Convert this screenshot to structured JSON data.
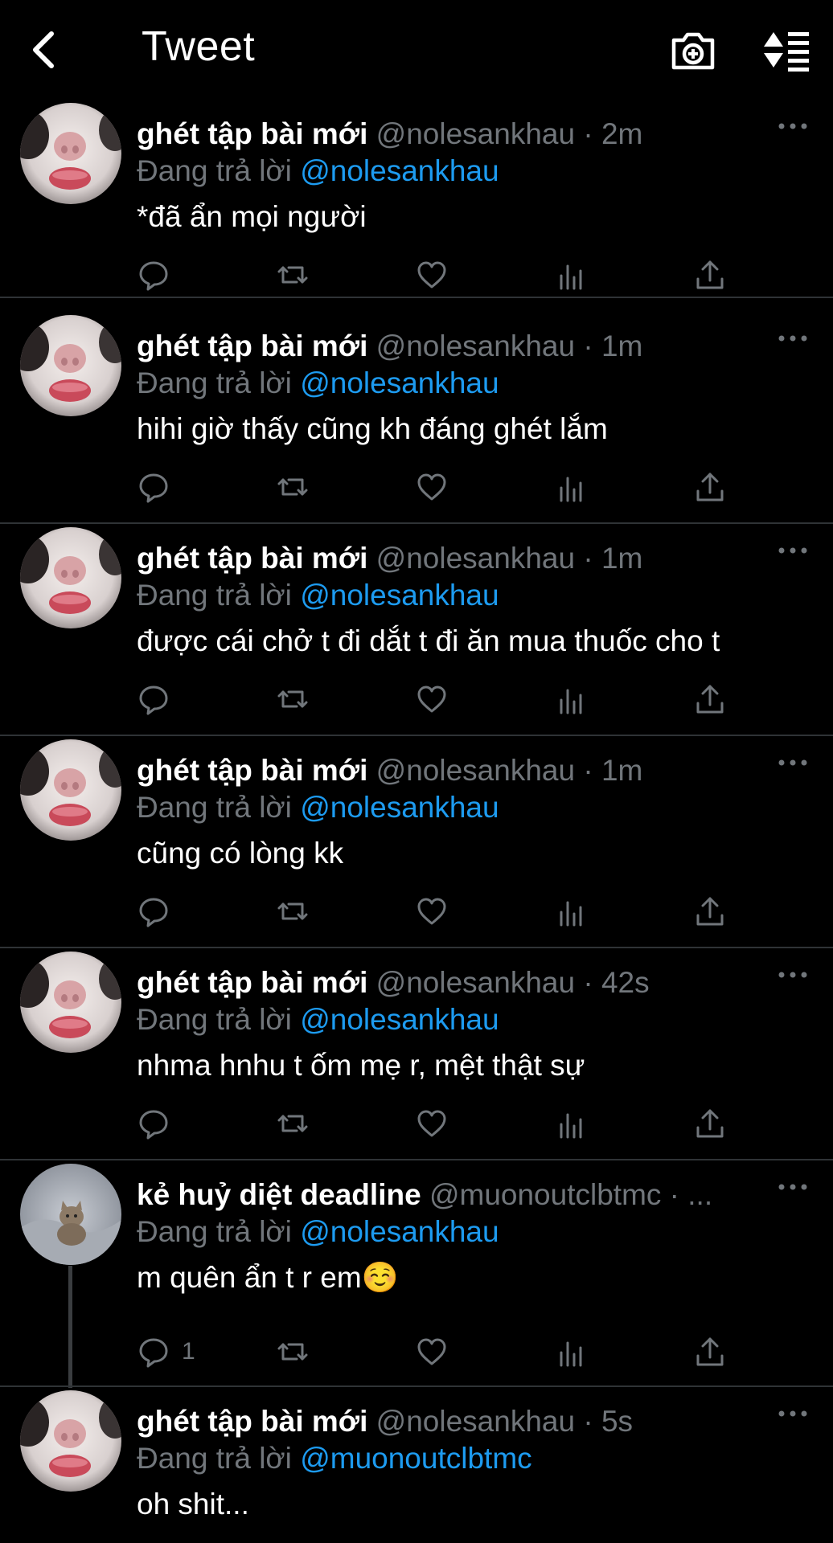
{
  "header": {
    "title": "Tweet",
    "back_icon": "chevron-left-icon",
    "camera_icon": "camera-icon",
    "sort_icon": "sort-icon"
  },
  "colors": {
    "background": "#000000",
    "link": "#1d9bf0",
    "muted": "#71767b"
  },
  "tweets": [
    {
      "name": "ghét tập bài mới",
      "handle": "@nolesankhau",
      "time": "· 2m",
      "reply_prefix": "Đang trả lời",
      "reply_to": "@nolesankhau",
      "text": "*đã ẩn mọi người",
      "reply_count": ""
    },
    {
      "name": "ghét tập bài mới",
      "handle": "@nolesankhau",
      "time": "· 1m",
      "reply_prefix": "Đang trả lời",
      "reply_to": "@nolesankhau",
      "text": "hihi giờ thấy cũng kh đáng ghét lắm",
      "reply_count": ""
    },
    {
      "name": "ghét tập bài mới",
      "handle": "@nolesankhau",
      "time": "· 1m",
      "reply_prefix": "Đang trả lời",
      "reply_to": "@nolesankhau",
      "text": "được cái chở t đi dắt t đi ăn mua thuốc cho t",
      "reply_count": ""
    },
    {
      "name": "ghét tập bài mới",
      "handle": "@nolesankhau",
      "time": "· 1m",
      "reply_prefix": "Đang trả lời",
      "reply_to": "@nolesankhau",
      "text": "cũng có lòng kk",
      "reply_count": ""
    },
    {
      "name": "ghét tập bài mới",
      "handle": "@nolesankhau",
      "time": "· 42s",
      "reply_prefix": "Đang trả lời",
      "reply_to": "@nolesankhau",
      "text": "nhma hnhu t ốm mẹ r, mệt thật sự",
      "reply_count": ""
    },
    {
      "name": "kẻ huỷ diệt deadline",
      "handle": "@muonoutclbtmc",
      "time": "· ...",
      "reply_prefix": "Đang trả lời",
      "reply_to": "@nolesankhau",
      "text": "m quên ẩn t r em☺️",
      "reply_count": "1"
    },
    {
      "name": "ghét tập bài mới",
      "handle": "@nolesankhau",
      "time": "· 5s",
      "reply_prefix": "Đang trả lời",
      "reply_to": "@muonoutclbtmc",
      "text": "oh shit...",
      "reply_count": ""
    }
  ]
}
